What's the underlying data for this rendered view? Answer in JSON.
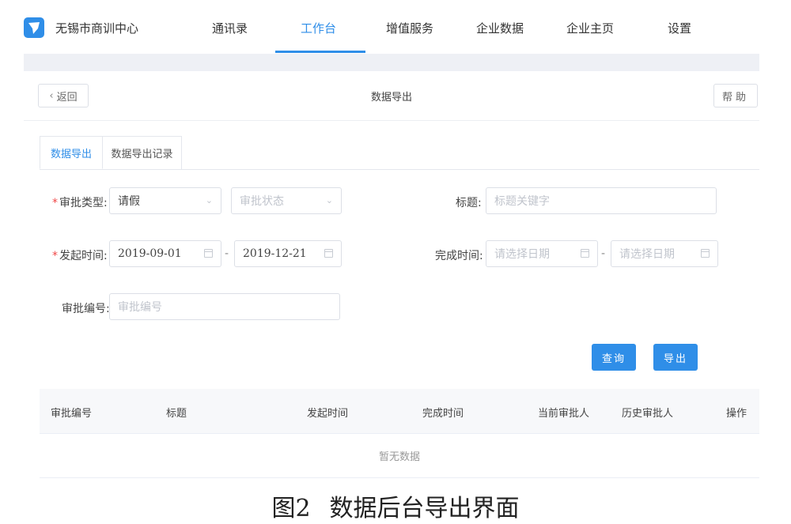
{
  "nav": {
    "org_name": "无锡市商训中心",
    "items": [
      "通讯录",
      "工作台",
      "增值服务",
      "企业数据",
      "企业主页",
      "设置"
    ],
    "active_index": 1
  },
  "header": {
    "back_label": "返回",
    "title": "数据导出",
    "help_label": "帮助"
  },
  "tabs": [
    "数据导出",
    "数据导出记录"
  ],
  "form": {
    "approval_type_label": "审批类型:",
    "approval_type_value": "请假",
    "approval_status_placeholder": "审批状态",
    "title_label": "标题:",
    "title_placeholder": "标题关键字",
    "start_time_label": "发起时间:",
    "start_from": "2019-09-01",
    "start_to": "2019-12-21",
    "finish_time_label": "完成时间:",
    "finish_from_placeholder": "请选择日期",
    "finish_to_placeholder": "请选择日期",
    "approval_no_label": "审批编号:",
    "approval_no_placeholder": "审批编号",
    "range_sep": "-"
  },
  "actions": {
    "query_label": "查询",
    "export_label": "导出"
  },
  "table": {
    "columns": [
      "审批编号",
      "标题",
      "发起时间",
      "完成时间",
      "当前审批人",
      "历史审批人",
      "操作"
    ],
    "empty_text": "暂无数据"
  },
  "caption": {
    "figure": "图2",
    "text": "数据后台导出界面"
  },
  "colors": {
    "accent": "#2f8ee8",
    "required": "#f04848"
  }
}
